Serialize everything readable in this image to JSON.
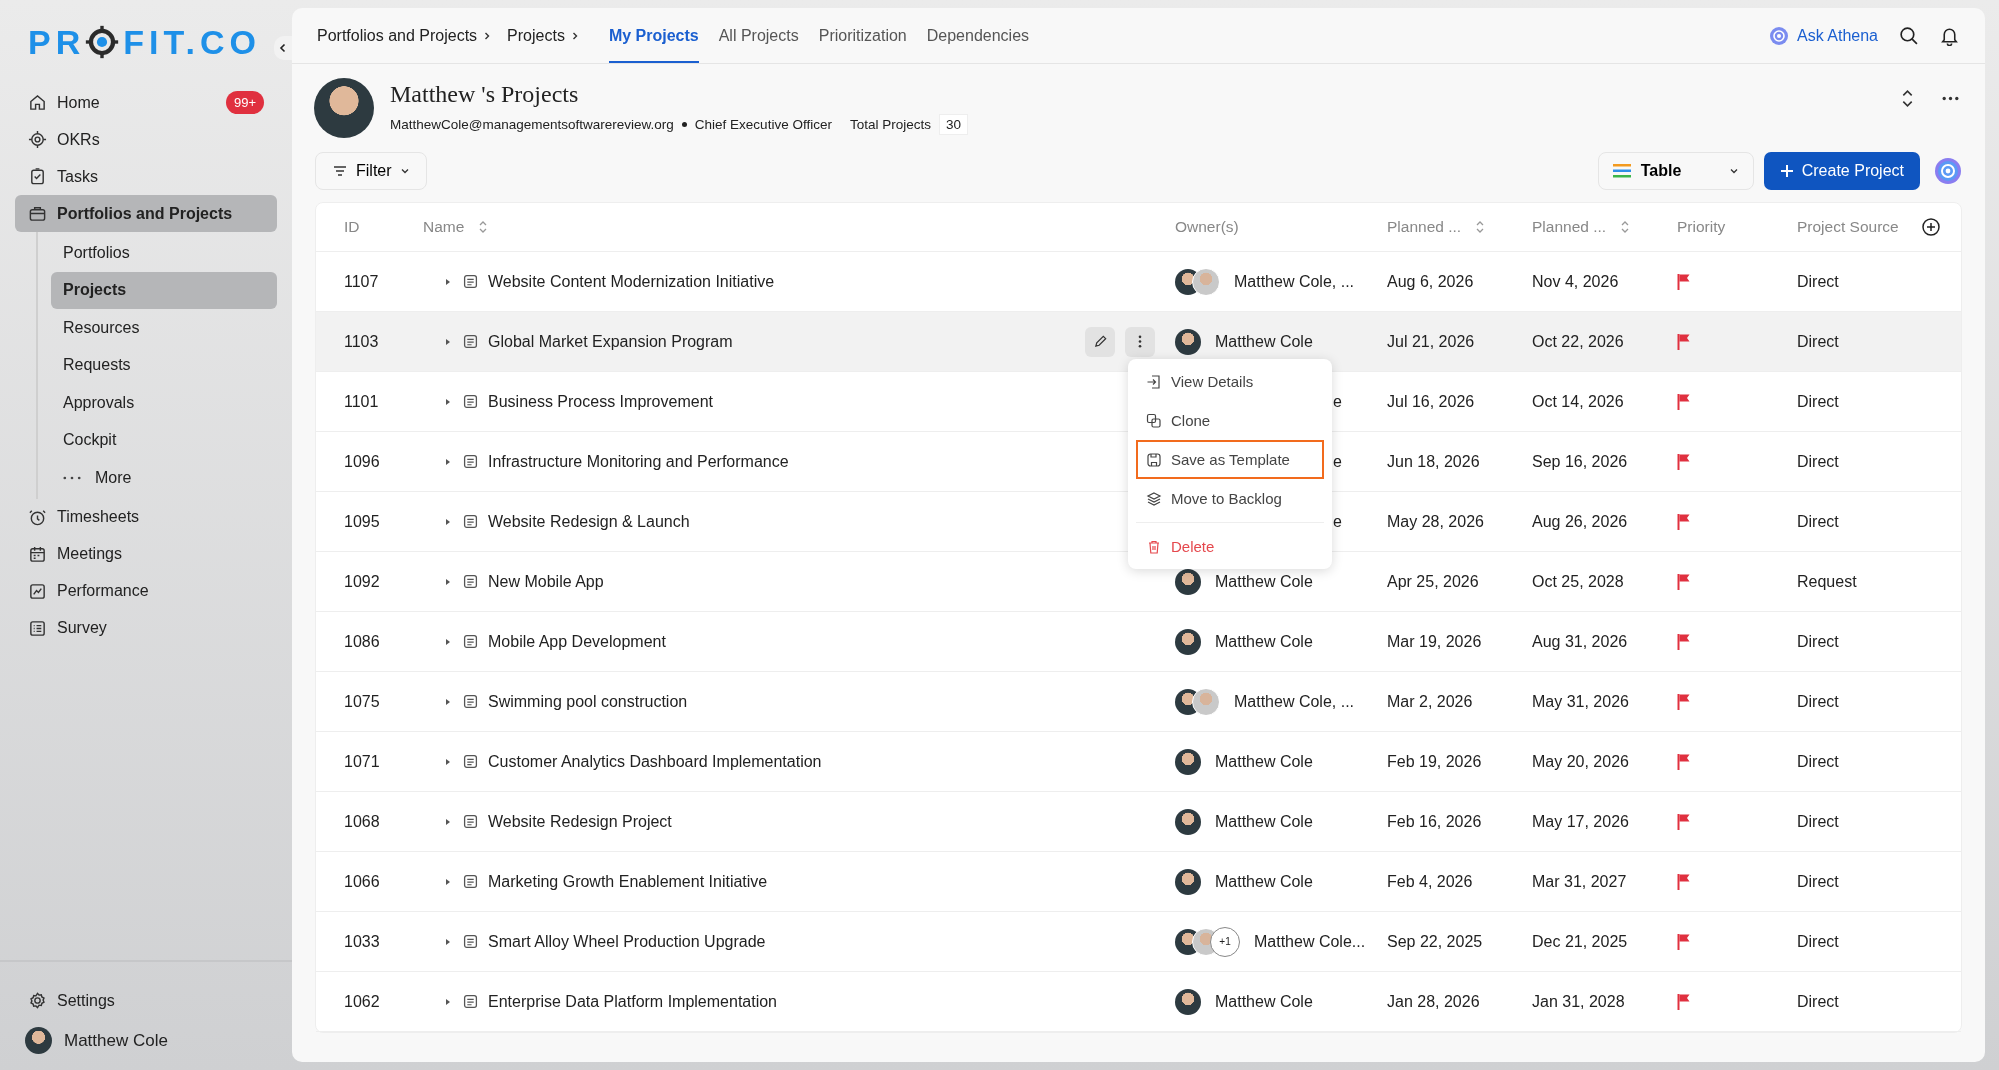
{
  "sidebar": {
    "logo": {
      "before": "PR",
      "after": "FIT.CO"
    },
    "items": [
      {
        "label": "Home",
        "badge": "99+",
        "selected": false
      },
      {
        "label": "OKRs",
        "selected": false
      },
      {
        "label": "Tasks",
        "selected": false
      },
      {
        "label": "Portfolios and Projects",
        "selected": true,
        "expanded": true,
        "children": [
          {
            "label": "Portfolios",
            "selected": false,
            "kind": "link"
          },
          {
            "label": "Projects",
            "selected": true,
            "kind": "link"
          },
          {
            "label": "Resources",
            "selected": false,
            "kind": "link"
          },
          {
            "label": "Requests",
            "selected": false,
            "kind": "link"
          },
          {
            "label": "Approvals",
            "selected": false,
            "kind": "link"
          },
          {
            "label": "Cockpit",
            "selected": false,
            "kind": "link"
          },
          {
            "label": "More",
            "selected": false,
            "kind": "more"
          }
        ]
      },
      {
        "label": "Timesheets",
        "selected": false
      },
      {
        "label": "Meetings",
        "selected": false
      },
      {
        "label": "Performance",
        "selected": false
      },
      {
        "label": "Survey",
        "selected": false
      }
    ],
    "settings": "Settings",
    "user": "Matthew Cole"
  },
  "topbar": {
    "breadcrumbs": [
      "Portfolios and Projects",
      "Projects"
    ],
    "tabs": [
      {
        "label": "My Projects",
        "selected": true
      },
      {
        "label": "All Projects",
        "selected": false
      },
      {
        "label": "Prioritization",
        "selected": false
      },
      {
        "label": "Dependencies",
        "selected": false
      }
    ],
    "assistant": "Ask Athena"
  },
  "profile": {
    "title": "Matthew 's Projects",
    "email": "MatthewCole@managementsoftwarereview.org",
    "role": "Chief Executive Officer",
    "total_label": "Total Projects",
    "total": "30"
  },
  "toolbar": {
    "filter": "Filter",
    "view": "Table",
    "create": "Create Project"
  },
  "table": {
    "columns": [
      {
        "label": "ID",
        "sortable": false
      },
      {
        "label": "Name",
        "sortable": true
      },
      {
        "label": "Owner(s)",
        "sortable": false
      },
      {
        "label": "Planned ...",
        "sortable": true
      },
      {
        "label": "Planned ...",
        "sortable": true
      },
      {
        "label": "Priority",
        "sortable": false
      },
      {
        "label": "Project Source",
        "sortable": false
      }
    ],
    "rows": [
      {
        "id": "1107",
        "name": "Website Content Modernization Initiative",
        "owner": "Matthew Cole, ...",
        "multiple_owners": true,
        "start": "Aug 6, 2026",
        "end": "Nov 4, 2026",
        "source": "Direct",
        "hovered": false
      },
      {
        "id": "1103",
        "name": "Global Market Expansion Program",
        "owner": "Matthew Cole",
        "multiple_owners": false,
        "start": "Jul 21, 2026",
        "end": "Oct 22, 2026",
        "source": "Direct",
        "hovered": true
      },
      {
        "id": "1101",
        "name": "Business Process Improvement",
        "owner": "e",
        "multiple_owners": false,
        "start": "Jul 16, 2026",
        "end": "Oct 14, 2026",
        "source": "Direct",
        "hovered": false,
        "covered": true
      },
      {
        "id": "1096",
        "name": "Infrastructure Monitoring and Performance",
        "owner": "e",
        "multiple_owners": false,
        "start": "Jun 18, 2026",
        "end": "Sep 16, 2026",
        "source": "Direct",
        "hovered": false,
        "covered": true
      },
      {
        "id": "1095",
        "name": "Website Redesign & Launch",
        "owner": "e",
        "multiple_owners": false,
        "start": "May 28, 2026",
        "end": "Aug 26, 2026",
        "source": "Direct",
        "hovered": false,
        "covered": true
      },
      {
        "id": "1092",
        "name": "New Mobile App",
        "owner": "Matthew Cole",
        "multiple_owners": false,
        "start": "Apr 25, 2026",
        "end": "Oct 25, 2028",
        "source": "Request",
        "hovered": false
      },
      {
        "id": "1086",
        "name": "Mobile App Development",
        "owner": "Matthew Cole",
        "multiple_owners": false,
        "start": "Mar 19, 2026",
        "end": "Aug 31, 2026",
        "source": "Direct",
        "hovered": false
      },
      {
        "id": "1075",
        "name": "Swimming pool construction",
        "owner": "Matthew Cole, ...",
        "multiple_owners": true,
        "start": "Mar 2, 2026",
        "end": "May 31, 2026",
        "source": "Direct",
        "hovered": false
      },
      {
        "id": "1071",
        "name": "Customer Analytics Dashboard Implementation",
        "owner": "Matthew Cole",
        "multiple_owners": false,
        "start": "Feb 19, 2026",
        "end": "May 20, 2026",
        "source": "Direct",
        "hovered": false
      },
      {
        "id": "1068",
        "name": "Website Redesign Project",
        "owner": "Matthew Cole",
        "multiple_owners": false,
        "start": "Feb 16, 2026",
        "end": "May 17, 2026",
        "source": "Direct",
        "hovered": false
      },
      {
        "id": "1066",
        "name": "Marketing Growth Enablement Initiative",
        "owner": "Matthew Cole",
        "multiple_owners": false,
        "start": "Feb 4, 2026",
        "end": "Mar 31, 2027",
        "source": "Direct",
        "hovered": false
      },
      {
        "id": "1033",
        "name": "Smart Alloy Wheel Production Upgrade",
        "owner": "Matthew Cole...",
        "multiple_owners": true,
        "extra_owners": "+1",
        "start": "Sep 22, 2025",
        "end": "Dec 21, 2025",
        "source": "Direct",
        "hovered": false
      },
      {
        "id": "1062",
        "name": "Enterprise Data Platform Implementation",
        "owner": "Matthew Cole",
        "multiple_owners": false,
        "start": "Jan 28, 2026",
        "end": "Jan 31, 2028",
        "source": "Direct",
        "hovered": false
      }
    ]
  },
  "context_menu": {
    "items": [
      {
        "label": "View Details",
        "kind": "normal",
        "highlighted": false
      },
      {
        "label": "Clone",
        "kind": "normal",
        "highlighted": false
      },
      {
        "label": "Save as Template",
        "kind": "normal",
        "highlighted": true
      },
      {
        "label": "Move to Backlog",
        "kind": "normal",
        "highlighted": false
      },
      {
        "label": "Delete",
        "kind": "danger",
        "highlighted": false
      }
    ]
  }
}
